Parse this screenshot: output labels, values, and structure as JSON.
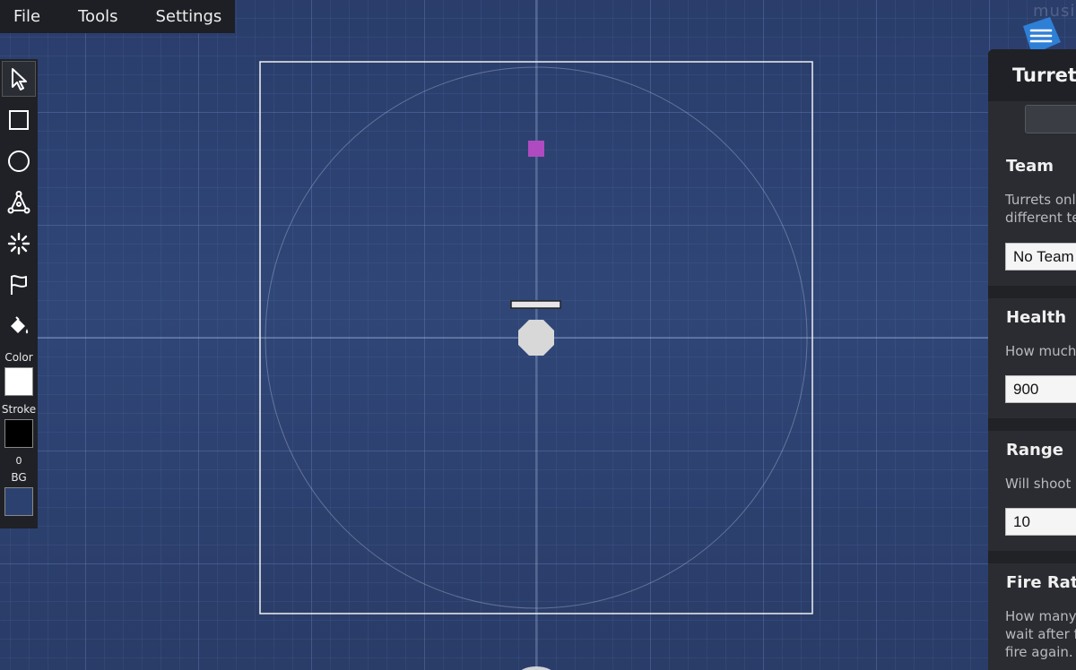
{
  "menubar": {
    "items": [
      "File",
      "Tools",
      "Settings"
    ]
  },
  "toolbar": {
    "tools": [
      {
        "name": "select-tool",
        "icon": "cursor-arrow-icon",
        "active": true
      },
      {
        "name": "rectangle-tool",
        "icon": "square-icon",
        "active": false
      },
      {
        "name": "circle-tool",
        "icon": "circle-icon",
        "active": false
      },
      {
        "name": "polygon-tool",
        "icon": "polygon-nodes-icon",
        "active": false
      },
      {
        "name": "spawn-tool",
        "icon": "burst-icon",
        "active": false
      },
      {
        "name": "flag-tool",
        "icon": "flag-icon",
        "active": false
      },
      {
        "name": "fill-tool",
        "icon": "paint-bucket-icon",
        "active": false
      }
    ],
    "color_label": "Color",
    "color_value": "#ffffff",
    "stroke_label": "Stroke",
    "stroke_color": "#000000",
    "stroke_width": "0",
    "bg_label": "BG",
    "bg_color": "#2c4170"
  },
  "logo": {
    "text": "musi"
  },
  "panel": {
    "title": "Turret S",
    "sections": [
      {
        "title": "Team",
        "desc": [
          "Turrets only",
          "different te"
        ],
        "value": "No Team"
      },
      {
        "title": "Health",
        "desc": [
          "How much"
        ],
        "value": "900"
      },
      {
        "title": "Range",
        "desc": [
          "Will shoot a"
        ],
        "value": "10"
      },
      {
        "title": "Fire Rate",
        "desc": [
          "How many",
          "wait after f",
          "fire again."
        ],
        "value": ""
      }
    ]
  },
  "colors": {
    "accent_marker": "#b04ac0",
    "turret": "#d8d8d8",
    "menu_diamond": "#2e7fd6"
  }
}
